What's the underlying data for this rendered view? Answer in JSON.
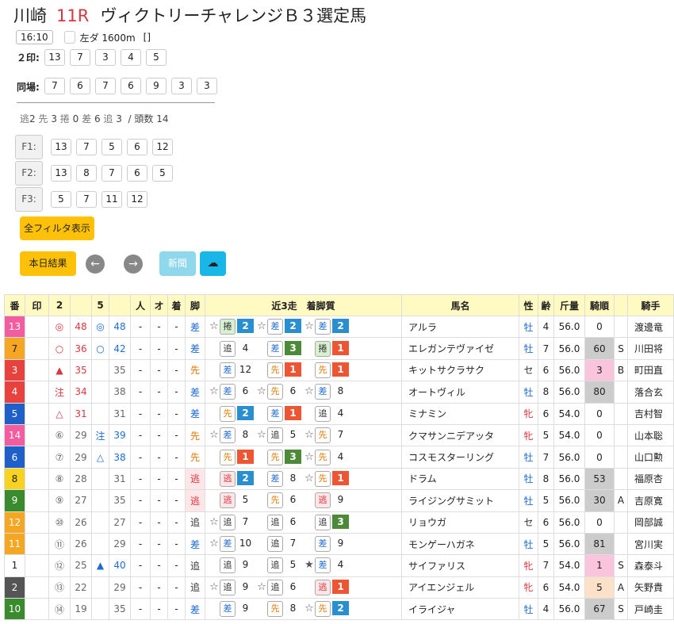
{
  "header": {
    "venue": "川崎",
    "race_no": "11R",
    "race_name": "ヴィクトリーチャレンジＢ３選定馬",
    "time": "16:10",
    "course": "左ダ 1600m",
    "bracket": "[]"
  },
  "marks2": {
    "label": "２印:",
    "nums": [
      "13",
      "7",
      "3",
      "4",
      "5"
    ]
  },
  "same_place": {
    "label": "同場:",
    "nums": [
      "7",
      "6",
      "7",
      "6",
      "9",
      "3",
      "3"
    ]
  },
  "stats": {
    "nige_k": "逃",
    "nige": "2",
    "sen_k": "先",
    "sen": "3",
    "makuri_k": "捲",
    "makuri": "0",
    "sashi_k": "差",
    "sashi": "6",
    "oi_k": "追",
    "oi": "3",
    "heads": "/ 頭数 14"
  },
  "filters": [
    {
      "label": "F1:",
      "nums": [
        "13",
        "7",
        "5",
        "6",
        "12"
      ]
    },
    {
      "label": "F2:",
      "nums": [
        "13",
        "8",
        "7",
        "6",
        "5"
      ]
    },
    {
      "label": "F3:",
      "nums": [
        "5",
        "7",
        "11",
        "12"
      ]
    }
  ],
  "buttons": {
    "all_filters": "全フィルタ表示",
    "today_results": "本日結果",
    "prev": "←",
    "next": "→",
    "news": "新聞",
    "download": "☁"
  },
  "table": {
    "headers": [
      "番",
      "印",
      "2",
      "",
      "5",
      "",
      "人",
      "オ",
      "着",
      "脚",
      "近3走　着脚質",
      "馬名",
      "性",
      "齢",
      "斤量",
      "騎順",
      "",
      "騎手"
    ],
    "rows": [
      {
        "no": "13",
        "noColor": "#f45ca0",
        "noFg": "#fff",
        "m2": "◎",
        "v2": "48",
        "m2c": "red",
        "m5": "◎",
        "v5": "48",
        "m5c": "blue",
        "ninki": "-",
        "o": "-",
        "chaku": "-",
        "style": "差",
        "sc": "sty-sa",
        "runs": [
          {
            "star": "☆",
            "s": "捲",
            "sc": "s-ma",
            "r": "2",
            "rc": "r2"
          },
          {
            "star": "☆",
            "s": "差",
            "sc": "s-sa",
            "r": "2",
            "rc": "r2"
          },
          {
            "star": "☆",
            "s": "差",
            "sc": "s-sa",
            "r": "2",
            "rc": "r2"
          }
        ],
        "name": "アルラ",
        "sex": "牡",
        "sexc": "male",
        "age": "4",
        "kin": "56.0",
        "kj": "0",
        "kjbg": "",
        "mark": "",
        "jockey": "渡邊竜"
      },
      {
        "no": "7",
        "noColor": "#f5a623",
        "noFg": "#222",
        "m2": "○",
        "v2": "36",
        "m2c": "red",
        "m5": "○",
        "v5": "42",
        "m5c": "blue",
        "ninki": "-",
        "o": "-",
        "chaku": "-",
        "style": "差",
        "sc": "sty-sa",
        "runs": [
          {
            "star": "",
            "s": "追",
            "sc": "s-oi",
            "r": "4",
            "rc": ""
          },
          {
            "star": "",
            "s": "差",
            "sc": "s-sa",
            "r": "3",
            "rc": "r3"
          },
          {
            "star": "",
            "s": "捲",
            "sc": "s-ma",
            "r": "1",
            "rc": "r1"
          }
        ],
        "name": "エレガンテヴァイゼ",
        "sex": "牡",
        "sexc": "male",
        "age": "7",
        "kin": "56.0",
        "kj": "60",
        "kjbg": "#cccccc",
        "mark": "S",
        "jockey": "川田将"
      },
      {
        "no": "3",
        "noColor": "#e8423f",
        "noFg": "#fff",
        "m2": "▲",
        "v2": "35",
        "m2c": "red",
        "m5": "",
        "v5": "35",
        "m5c": "gray",
        "ninki": "-",
        "o": "-",
        "chaku": "-",
        "style": "先",
        "sc": "sty-sen",
        "runs": [
          {
            "star": "",
            "s": "差",
            "sc": "s-sa",
            "r": "12",
            "rc": ""
          },
          {
            "star": "",
            "s": "先",
            "sc": "s-se",
            "r": "1",
            "rc": "r1"
          },
          {
            "star": "",
            "s": "先",
            "sc": "s-se",
            "r": "1",
            "rc": "r1"
          }
        ],
        "name": "キットサクラサク",
        "sex": "セ",
        "sexc": "gelding",
        "age": "6",
        "kin": "56.0",
        "kj": "3",
        "kjbg": "#f9c4dc",
        "mark": "B",
        "jockey": "町田直"
      },
      {
        "no": "4",
        "noColor": "#e8423f",
        "noFg": "#fff",
        "m2": "注",
        "v2": "34",
        "m2c": "red",
        "m5": "",
        "v5": "38",
        "m5c": "gray",
        "ninki": "-",
        "o": "-",
        "chaku": "-",
        "style": "差",
        "sc": "sty-sa",
        "runs": [
          {
            "star": "☆",
            "s": "差",
            "sc": "s-sa",
            "r": "6",
            "rc": ""
          },
          {
            "star": "☆",
            "s": "先",
            "sc": "s-se",
            "r": "6",
            "rc": ""
          },
          {
            "star": "☆",
            "s": "差",
            "sc": "s-sa",
            "r": "8",
            "rc": ""
          }
        ],
        "name": "オートヴィル",
        "sex": "牡",
        "sexc": "male",
        "age": "8",
        "kin": "56.0",
        "kj": "80",
        "kjbg": "#cccccc",
        "mark": "",
        "jockey": "落合玄"
      },
      {
        "no": "5",
        "noColor": "#1f5fc8",
        "noFg": "#fff",
        "m2": "△",
        "v2": "31",
        "m2c": "red",
        "m5": "",
        "v5": "31",
        "m5c": "gray",
        "ninki": "-",
        "o": "-",
        "chaku": "-",
        "style": "差",
        "sc": "sty-sa",
        "runs": [
          {
            "star": "",
            "s": "先",
            "sc": "s-se",
            "r": "2",
            "rc": "r2"
          },
          {
            "star": "",
            "s": "差",
            "sc": "s-sa",
            "r": "1",
            "rc": "r1"
          },
          {
            "star": "",
            "s": "追",
            "sc": "s-oi",
            "r": "4",
            "rc": ""
          }
        ],
        "name": "ミナミン",
        "sex": "牝",
        "sexc": "female",
        "age": "6",
        "kin": "54.0",
        "kj": "0",
        "kjbg": "",
        "mark": "",
        "jockey": "吉村智"
      },
      {
        "no": "14",
        "noColor": "#f45ca0",
        "noFg": "#fff",
        "m2": "⑥",
        "v2": "29",
        "m2c": "gray",
        "m5": "注",
        "v5": "39",
        "m5c": "blue",
        "ninki": "-",
        "o": "-",
        "chaku": "-",
        "style": "先",
        "sc": "sty-sen",
        "runs": [
          {
            "star": "☆",
            "s": "差",
            "sc": "s-sa",
            "r": "8",
            "rc": ""
          },
          {
            "star": "☆",
            "s": "追",
            "sc": "s-oi",
            "r": "5",
            "rc": ""
          },
          {
            "star": "☆",
            "s": "先",
            "sc": "s-se",
            "r": "7",
            "rc": ""
          }
        ],
        "name": "クマサンニデアッタ",
        "sex": "牝",
        "sexc": "female",
        "age": "5",
        "kin": "54.0",
        "kj": "0",
        "kjbg": "",
        "mark": "",
        "jockey": "山本聡"
      },
      {
        "no": "6",
        "noColor": "#1f5fc8",
        "noFg": "#fff",
        "m2": "⑦",
        "v2": "29",
        "m2c": "gray",
        "m5": "△",
        "v5": "38",
        "m5c": "blue",
        "ninki": "-",
        "o": "-",
        "chaku": "-",
        "style": "先",
        "sc": "sty-sen",
        "runs": [
          {
            "star": "",
            "s": "先",
            "sc": "s-se",
            "r": "1",
            "rc": "r1"
          },
          {
            "star": "",
            "s": "先",
            "sc": "s-se",
            "r": "3",
            "rc": "r3"
          },
          {
            "star": "☆",
            "s": "先",
            "sc": "s-se",
            "r": "4",
            "rc": ""
          }
        ],
        "name": "コスモスターリング",
        "sex": "牡",
        "sexc": "male",
        "age": "7",
        "kin": "56.0",
        "kj": "0",
        "kjbg": "",
        "mark": "",
        "jockey": "山口勲"
      },
      {
        "no": "8",
        "noColor": "#f7d21e",
        "noFg": "#222",
        "m2": "⑧",
        "v2": "28",
        "m2c": "gray",
        "m5": "",
        "v5": "31",
        "m5c": "gray",
        "ninki": "-",
        "o": "-",
        "chaku": "-",
        "style": "逃",
        "sc": "sty-nige",
        "runs": [
          {
            "star": "",
            "s": "逃",
            "sc": "s-ni",
            "r": "2",
            "rc": "r2"
          },
          {
            "star": "",
            "s": "差",
            "sc": "s-sa",
            "r": "8",
            "rc": ""
          },
          {
            "star": "☆",
            "s": "先",
            "sc": "s-se",
            "r": "1",
            "rc": "r1"
          }
        ],
        "name": "ドラム",
        "sex": "牡",
        "sexc": "male",
        "age": "8",
        "kin": "56.0",
        "kj": "53",
        "kjbg": "#cccccc",
        "mark": "",
        "jockey": "福原杏"
      },
      {
        "no": "9",
        "noColor": "#3a8a2e",
        "noFg": "#fff",
        "m2": "⑨",
        "v2": "27",
        "m2c": "gray",
        "m5": "",
        "v5": "35",
        "m5c": "gray",
        "ninki": "-",
        "o": "-",
        "chaku": "-",
        "style": "逃",
        "sc": "sty-nige",
        "runs": [
          {
            "star": "",
            "s": "逃",
            "sc": "s-ni",
            "r": "5",
            "rc": ""
          },
          {
            "star": "",
            "s": "先",
            "sc": "s-se",
            "r": "6",
            "rc": ""
          },
          {
            "star": "",
            "s": "逃",
            "sc": "s-ni",
            "r": "9",
            "rc": ""
          }
        ],
        "name": "ライジングサミット",
        "sex": "牡",
        "sexc": "male",
        "age": "5",
        "kin": "56.0",
        "kj": "30",
        "kjbg": "#cccccc",
        "mark": "A",
        "jockey": "吉原寛"
      },
      {
        "no": "12",
        "noColor": "#f5a623",
        "noFg": "#fff",
        "m2": "⑩",
        "v2": "26",
        "m2c": "gray",
        "m5": "",
        "v5": "27",
        "m5c": "gray",
        "ninki": "-",
        "o": "-",
        "chaku": "-",
        "style": "追",
        "sc": "sty-oi",
        "runs": [
          {
            "star": "☆",
            "s": "追",
            "sc": "s-oi",
            "r": "7",
            "rc": ""
          },
          {
            "star": "",
            "s": "追",
            "sc": "s-oi",
            "r": "6",
            "rc": ""
          },
          {
            "star": "",
            "s": "追",
            "sc": "s-oi",
            "r": "3",
            "rc": "r3"
          }
        ],
        "name": "リョウガ",
        "sex": "セ",
        "sexc": "gelding",
        "age": "6",
        "kin": "56.0",
        "kj": "0",
        "kjbg": "",
        "mark": "",
        "jockey": "岡部誠"
      },
      {
        "no": "11",
        "noColor": "#f5a623",
        "noFg": "#fff",
        "m2": "⑪",
        "v2": "26",
        "m2c": "gray",
        "m5": "",
        "v5": "29",
        "m5c": "gray",
        "ninki": "-",
        "o": "-",
        "chaku": "-",
        "style": "差",
        "sc": "sty-sa",
        "runs": [
          {
            "star": "☆",
            "s": "差",
            "sc": "s-sa",
            "r": "10",
            "rc": ""
          },
          {
            "star": "",
            "s": "追",
            "sc": "s-oi",
            "r": "7",
            "rc": ""
          },
          {
            "star": "",
            "s": "差",
            "sc": "s-sa",
            "r": "9",
            "rc": ""
          }
        ],
        "name": "モンゲーハガネ",
        "sex": "牡",
        "sexc": "male",
        "age": "5",
        "kin": "56.0",
        "kj": "81",
        "kjbg": "#cccccc",
        "mark": "",
        "jockey": "宮川実"
      },
      {
        "no": "1",
        "noColor": "#ffffff",
        "noFg": "#222",
        "m2": "⑫",
        "v2": "25",
        "m2c": "gray",
        "m5": "▲",
        "v5": "40",
        "m5c": "blue",
        "ninki": "-",
        "o": "-",
        "chaku": "-",
        "style": "追",
        "sc": "sty-oi",
        "runs": [
          {
            "star": "",
            "s": "追",
            "sc": "s-oi",
            "r": "9",
            "rc": ""
          },
          {
            "star": "",
            "s": "追",
            "sc": "s-oi",
            "r": "5",
            "rc": ""
          },
          {
            "star": "★",
            "s": "差",
            "sc": "s-sa",
            "r": "4",
            "rc": ""
          }
        ],
        "name": "サイファリス",
        "sex": "牝",
        "sexc": "female",
        "age": "7",
        "kin": "54.0",
        "kj": "1",
        "kjbg": "#f9c4dc",
        "mark": "S",
        "jockey": "森泰斗"
      },
      {
        "no": "2",
        "noColor": "#555555",
        "noFg": "#fff",
        "m2": "⑬",
        "v2": "22",
        "m2c": "gray",
        "m5": "",
        "v5": "29",
        "m5c": "gray",
        "ninki": "-",
        "o": "-",
        "chaku": "-",
        "style": "追",
        "sc": "sty-oi",
        "runs": [
          {
            "star": "☆",
            "s": "追",
            "sc": "s-oi",
            "r": "9",
            "rc": ""
          },
          {
            "star": "☆",
            "s": "追",
            "sc": "s-oi",
            "r": "6",
            "rc": ""
          },
          {
            "star": "",
            "s": "逃",
            "sc": "s-ni",
            "r": "1",
            "rc": "r1"
          }
        ],
        "name": "アイエンジェル",
        "sex": "牝",
        "sexc": "female",
        "age": "6",
        "kin": "54.0",
        "kj": "5",
        "kjbg": "#fde0c8",
        "mark": "A",
        "jockey": "矢野貴"
      },
      {
        "no": "10",
        "noColor": "#3a8a2e",
        "noFg": "#fff",
        "m2": "⑭",
        "v2": "19",
        "m2c": "gray",
        "m5": "",
        "v5": "35",
        "m5c": "gray",
        "ninki": "-",
        "o": "-",
        "chaku": "-",
        "style": "差",
        "sc": "sty-sa",
        "runs": [
          {
            "star": "",
            "s": "差",
            "sc": "s-sa",
            "r": "9",
            "rc": ""
          },
          {
            "star": "",
            "s": "先",
            "sc": "s-se",
            "r": "8",
            "rc": ""
          },
          {
            "star": "☆",
            "s": "先",
            "sc": "s-se",
            "r": "2",
            "rc": "r2"
          }
        ],
        "name": "イライジャ",
        "sex": "牡",
        "sexc": "male",
        "age": "4",
        "kin": "56.0",
        "kj": "67",
        "kjbg": "#cccccc",
        "mark": "S",
        "jockey": "戸崎圭"
      }
    ]
  }
}
